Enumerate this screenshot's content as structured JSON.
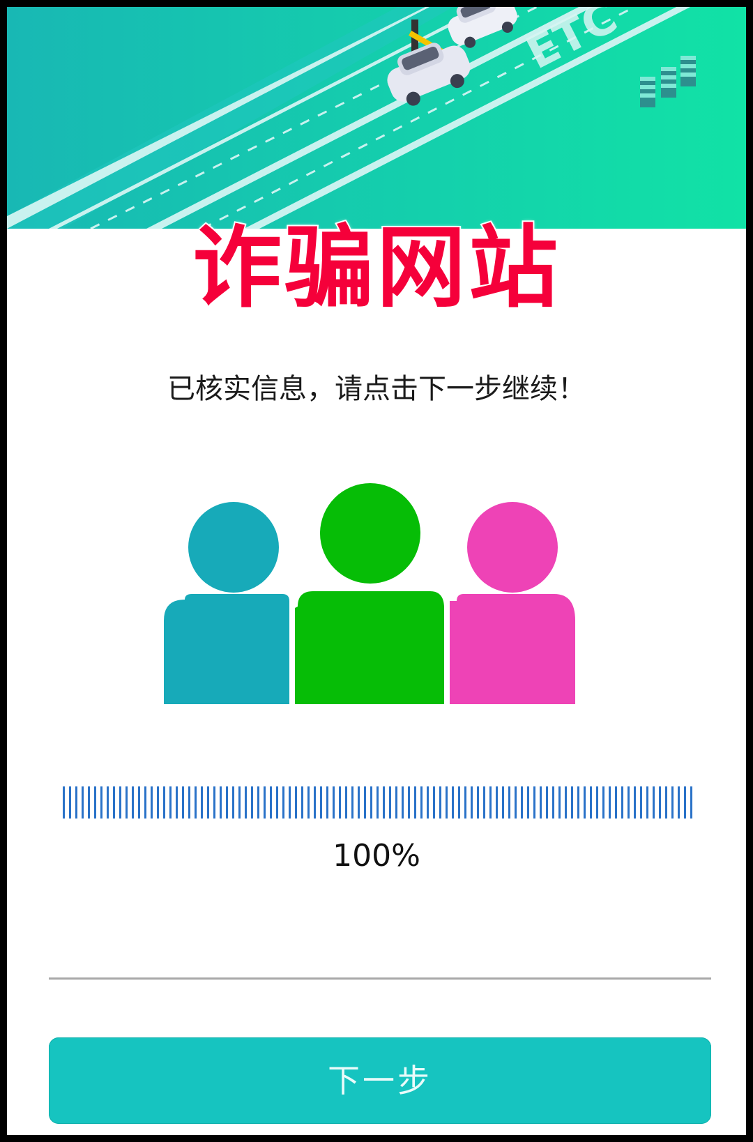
{
  "banner": {
    "road_sign_text": "ETC",
    "colors": {
      "gradient_start": "#18b8b4",
      "gradient_end": "#11e2a6",
      "road": "#c9f2ef",
      "car": "#e6e8f2"
    }
  },
  "overlay": {
    "warning_title": "诈骗网站",
    "color": "#f5003a"
  },
  "content": {
    "info_text": "已核实信息，请点击下一步继续！",
    "illustration": {
      "icon": "users-group-icon",
      "colors": [
        "#17aab9",
        "#06bd06",
        "#ee43b6"
      ]
    },
    "progress": {
      "value": 1.0,
      "label": "100%",
      "color": "#2a72c8"
    }
  },
  "actions": {
    "next_label": "下一步",
    "next_color": "#16c4c0"
  }
}
